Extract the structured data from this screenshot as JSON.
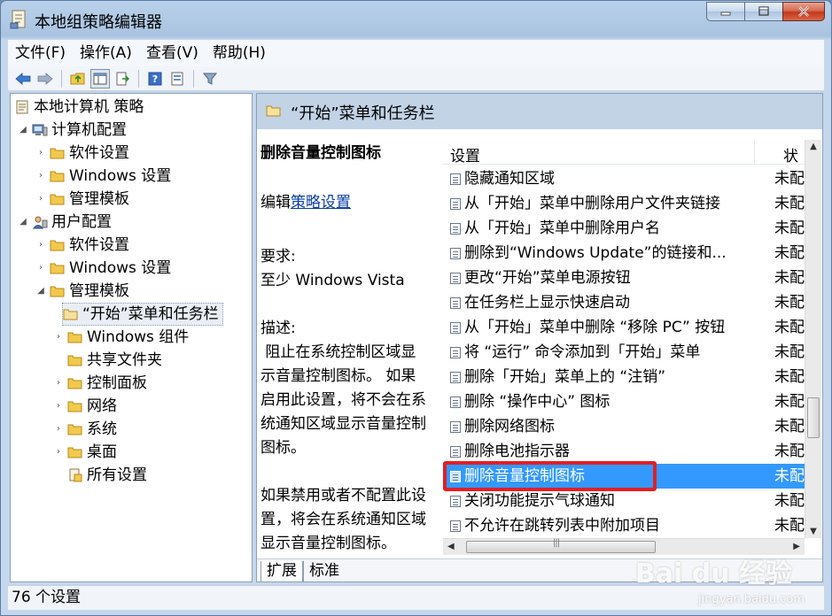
{
  "window": {
    "title": "本地组策略编辑器"
  },
  "menubar": {
    "items": [
      "文件(F)",
      "操作(A)",
      "查看(V)",
      "帮助(H)"
    ]
  },
  "toolbar": {
    "icons": [
      "back-icon",
      "forward-icon",
      "up-folder-icon",
      "show-hide-tree-icon",
      "export-list-icon",
      "help-icon",
      "properties-icon",
      "filter-icon"
    ]
  },
  "tree": {
    "root": "本地计算机 策略",
    "computer_config": "计算机配置",
    "cc_software": "软件设置",
    "cc_windows": "Windows 设置",
    "cc_admin": "管理模板",
    "user_config": "用户配置",
    "uc_software": "软件设置",
    "uc_windows": "Windows 设置",
    "uc_admin": "管理模板",
    "start_menu": "“开始”菜单和任务栏",
    "windows_components": "Windows 组件",
    "shared_folders": "共享文件夹",
    "control_panel": "控制面板",
    "network": "网络",
    "system": "系统",
    "desktop": "桌面",
    "all_settings": "所有设置"
  },
  "right": {
    "header_title": "“开始”菜单和任务栏",
    "desc": {
      "heading": "删除音量控制图标",
      "edit_prefix": "编辑",
      "edit_link": "策略设置",
      "req_label": "要求:",
      "req_value": "至少 Windows Vista",
      "desc_label": "描述:",
      "desc_text_1": " 阻止在系统控制区域显示音量控制图标。 如果启用此设置，将不会在系统通知区域显示音量控制图标。",
      "desc_text_2": "如果禁用或者不配置此设置，将会在系统通知区域显示音量控制图标。"
    },
    "list": {
      "col_setting": "设置",
      "col_state": "状",
      "rows": [
        {
          "name": "隐藏通知区域",
          "state": "未配置"
        },
        {
          "name": "从「开始」菜单中删除用户文件夹链接",
          "state": "未配置"
        },
        {
          "name": "从「开始」菜单中删除用户名",
          "state": "未配置"
        },
        {
          "name": "删除到“Windows Update”的链接和...",
          "state": "未配置"
        },
        {
          "name": "更改“开始”菜单电源按钮",
          "state": "未配置"
        },
        {
          "name": "在任务栏上显示快速启动",
          "state": "未配置"
        },
        {
          "name": "从「开始」菜单中删除 “移除 PC” 按钮",
          "state": "未配置"
        },
        {
          "name": "将 “运行” 命令添加到「开始」菜单",
          "state": "未配置"
        },
        {
          "name": "删除「开始」菜单上的 “注销”",
          "state": "未配置"
        },
        {
          "name": "删除 “操作中心” 图标",
          "state": "未配置"
        },
        {
          "name": "删除网络图标",
          "state": "未配置"
        },
        {
          "name": "删除电池指示器",
          "state": "未配置"
        },
        {
          "name": "删除音量控制图标",
          "state": "未配置"
        },
        {
          "name": "关闭功能提示气球通知",
          "state": "未配置"
        },
        {
          "name": "不允许在跳转列表中附加项目",
          "state": "未配置"
        }
      ],
      "selected_index": 12
    },
    "tabs": [
      "扩展",
      "标准"
    ]
  },
  "status": {
    "text": "76 个设置"
  },
  "watermark": {
    "text": "Bai du 经验",
    "sub": "jingyan.baidu.com"
  },
  "colors": {
    "selection": "#3399ff",
    "highlight_box": "#e31e26",
    "link": "#0a3fa9",
    "folder": "#f2c94c"
  }
}
